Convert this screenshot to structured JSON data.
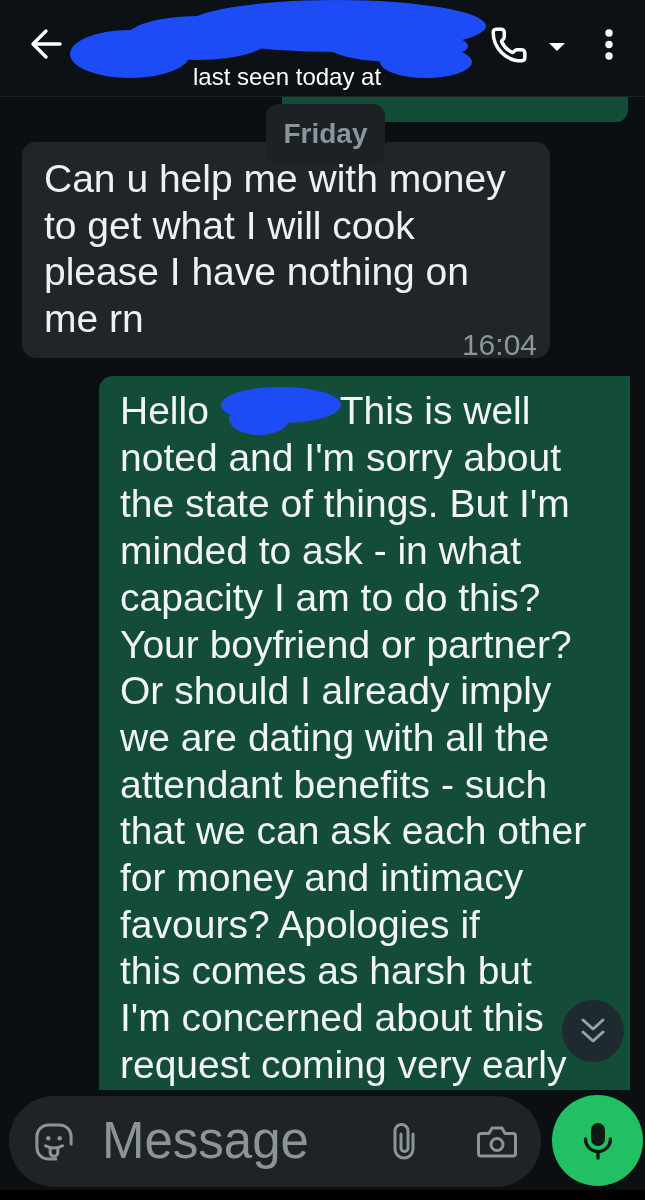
{
  "header": {
    "redacted": true,
    "status": "last seen today at"
  },
  "chat": {
    "date_chip": "Friday",
    "messages": [
      {
        "kind": "outgoing"
      },
      {
        "kind": "incoming",
        "text": "Can u help me with money\nto get what I will cook\nplease I have nothing on\nme rn",
        "time": "16:04"
      },
      {
        "kind": "outgoing",
        "text_before_redaction": "Hello",
        "redacted": true,
        "text_after_redaction": "This is well\nnoted and I'm sorry about\nthe state of things. But I'm\nminded to ask - in what\ncapacity I am to do this?\nYour boyfriend or partner?\nOr should I already imply\nwe are dating with all the\nattendant benefits - such\nthat we can ask each other\nfor money and intimacy\nfavours? Apologies if\nthis comes as harsh but\nI'm concerned about this\nrequest coming very early"
      }
    ]
  },
  "composer": {
    "placeholder": "Message"
  }
}
